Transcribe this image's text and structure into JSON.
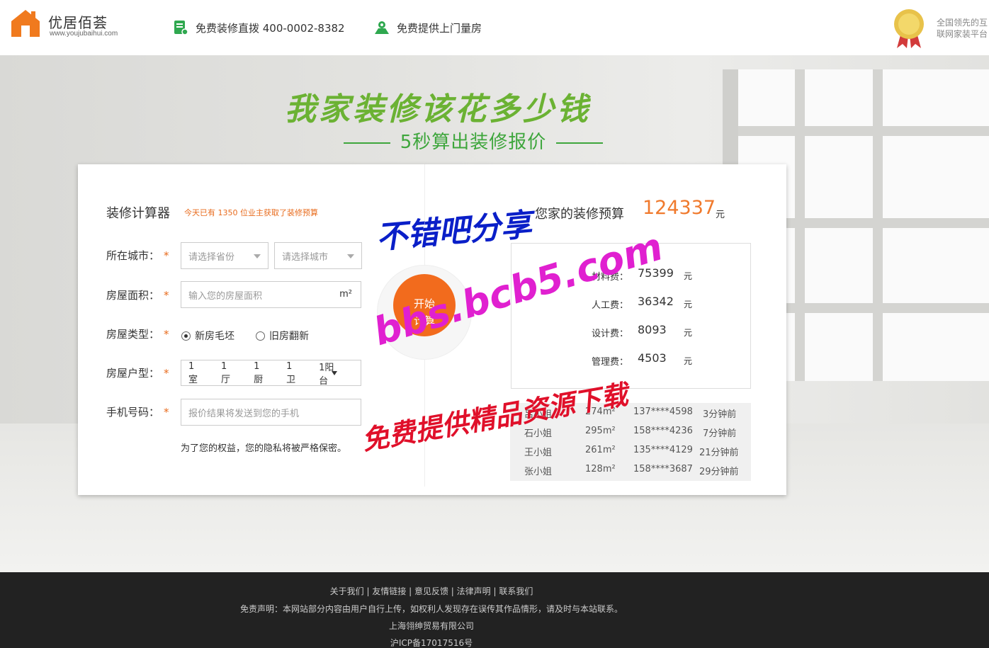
{
  "header": {
    "logo_name": "优居佰荟",
    "logo_url": "www.youjubaihui.com",
    "hotline": "免费装修直拨 400-0002-8382",
    "survey": "免费提供上门量房",
    "slogan_line1": "全国领先的互",
    "slogan_line2": "联网家装平台"
  },
  "hero": {
    "title": "我家装修该花多少钱",
    "subtitle": "5秒算出装修报价"
  },
  "calculator": {
    "title": "装修计算器",
    "count_text": "今天已有  1350  位业主获取了装修预算",
    "city_label": "所在城市：",
    "province_placeholder": "请选择省份",
    "city_placeholder": "请选择城市",
    "area_label": "房屋面积：",
    "area_placeholder": "输入您的房屋面积",
    "area_unit": "m²",
    "type_label": "房屋类型：",
    "type_new": "新房毛坯",
    "type_old": "旧房翻新",
    "layout_label": "房屋户型：",
    "layout": [
      "1室",
      "1厅",
      "1厨",
      "1卫",
      "1阳台"
    ],
    "phone_label": "手机号码：",
    "phone_placeholder": "报价结果将发送到您的手机",
    "privacy": "为了您的权益，您的隐私将被严格保密。",
    "star": "*",
    "go_line1": "开始",
    "go_line2": "计算"
  },
  "result": {
    "budget_label": "您家的装修预算",
    "budget_value": "124337",
    "budget_unit": "元",
    "costs": [
      {
        "name": "材料费：",
        "value": "75399",
        "unit": "元"
      },
      {
        "name": "人工费：",
        "value": "36342",
        "unit": "元"
      },
      {
        "name": "设计费：",
        "value": "8093",
        "unit": "元"
      },
      {
        "name": "管理费：",
        "value": "4503",
        "unit": "元"
      }
    ],
    "recent": [
      {
        "name": "吕小姐",
        "area": "274m²",
        "phone": "137****4598",
        "time": "3分钟前"
      },
      {
        "name": "石小姐",
        "area": "295m²",
        "phone": "158****4236",
        "time": "7分钟前"
      },
      {
        "name": "王小姐",
        "area": "261m²",
        "phone": "135****4129",
        "time": "21分钟前"
      },
      {
        "name": "张小姐",
        "area": "128m²",
        "phone": "158****3687",
        "time": "29分钟前"
      }
    ]
  },
  "watermark": {
    "line1": "不错吧分享",
    "line2": "bbs.bcb5.com",
    "line3": "免费提供精品资源下载"
  },
  "footer": {
    "links": "关于我们 | 友情链接 | 意见反馈 | 法律声明 | 联系我们",
    "disclaimer": "免责声明：本网站部分内容由用户自行上传，如权利人发现存在误传其作品情形，请及时与本站联系。",
    "company": "上海翎绅贸易有限公司",
    "icp": "沪ICP备17017516号"
  },
  "colors": {
    "brand_orange": "#f26b1d",
    "brand_green": "#6bb233",
    "footer_bg": "#222222"
  }
}
